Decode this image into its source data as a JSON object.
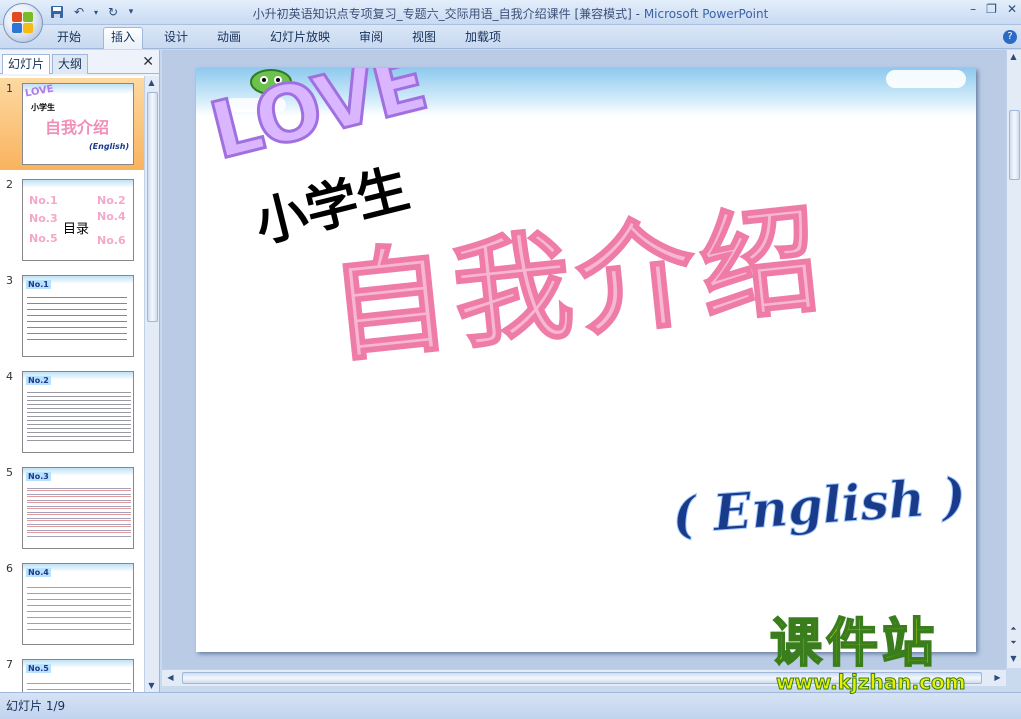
{
  "window": {
    "title": "小升初英语知识点专项复习_专题六_交际用语_自我介绍课件 [兼容模式] -",
    "app_name": "Microsoft PowerPoint"
  },
  "ribbon": {
    "tabs": [
      {
        "label": "开始"
      },
      {
        "label": "插入"
      },
      {
        "label": "设计"
      },
      {
        "label": "动画"
      },
      {
        "label": "幻灯片放映"
      },
      {
        "label": "审阅"
      },
      {
        "label": "视图"
      },
      {
        "label": "加载项"
      }
    ],
    "active_tab": "插入"
  },
  "left_pane": {
    "tab_slides": "幻灯片",
    "tab_outline": "大纲",
    "thumbnails": [
      {
        "num": "1",
        "line1": "LOVE",
        "line2": "小学生",
        "line3": "自我介绍",
        "line4": "(English)"
      },
      {
        "num": "2",
        "items": [
          "No.1",
          "No.2",
          "No.3",
          "No.4",
          "No.5",
          "No.6"
        ],
        "center": "目录"
      },
      {
        "num": "3",
        "badge": "No.1"
      },
      {
        "num": "4",
        "badge": "No.2"
      },
      {
        "num": "5",
        "badge": "No.3"
      },
      {
        "num": "6",
        "badge": "No.4"
      },
      {
        "num": "7",
        "badge": "No.5"
      }
    ]
  },
  "slide": {
    "love": "LOVE",
    "subtitle": "小学生",
    "title": "自我介绍",
    "english": "( English )"
  },
  "status": {
    "slide_indicator": "幻灯片 1/9"
  },
  "watermark": {
    "title": "课件站",
    "url": "www.kjzhan.com"
  },
  "colors": {
    "selected_thumb": "#f9b35e",
    "title_pink": "#f080b0",
    "love_purple": "#a070e0",
    "english_blue": "#1a3a8a"
  }
}
